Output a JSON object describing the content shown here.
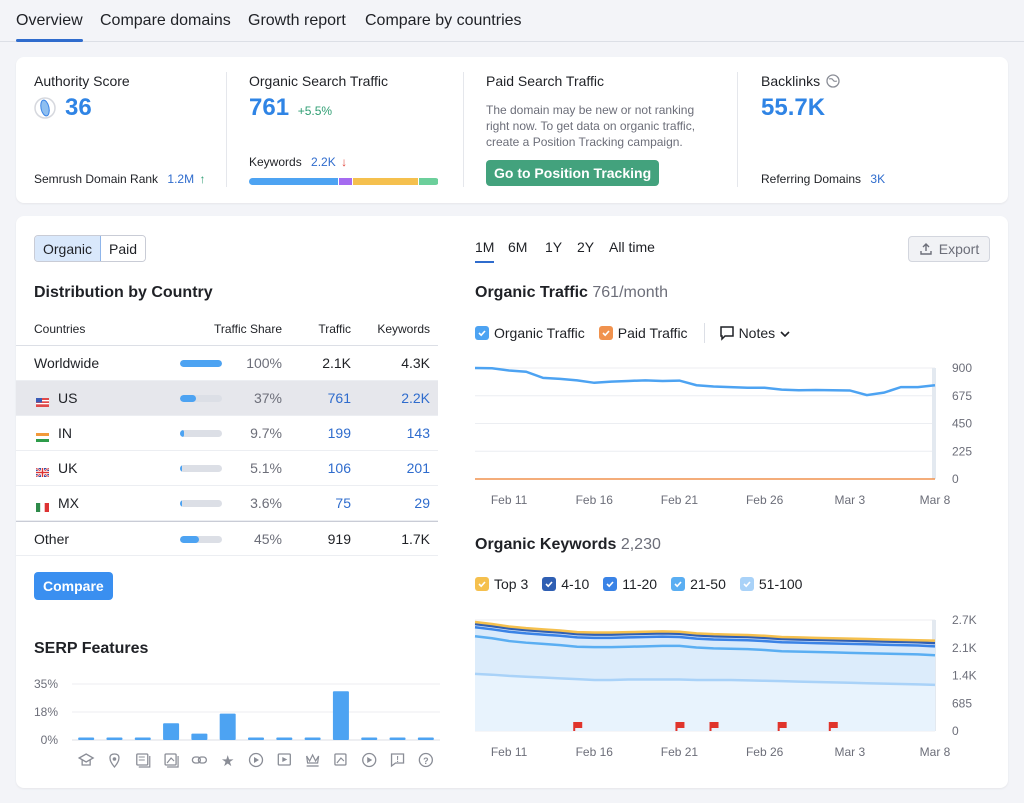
{
  "tabs": [
    {
      "label": "Overview",
      "active": true
    },
    {
      "label": "Compare domains",
      "active": false
    },
    {
      "label": "Growth report",
      "active": false
    },
    {
      "label": "Compare by countries",
      "active": false
    }
  ],
  "metrics": {
    "authority": {
      "label": "Authority Score",
      "value": "36",
      "rank_label": "Semrush Domain Rank",
      "rank_value": "1.2M",
      "rank_trend": "↑"
    },
    "organic": {
      "label": "Organic Search Traffic",
      "value": "761",
      "change": "+5.5%",
      "keywords_label": "Keywords",
      "keywords_value": "2.2K",
      "keywords_trend": "↓",
      "keyword_distribution": [
        {
          "name": "segment-1",
          "share": 0.48,
          "color": "#4da3f2"
        },
        {
          "name": "segment-2",
          "share": 0.07,
          "color": "#a56bf0"
        },
        {
          "name": "segment-3",
          "share": 0.35,
          "color": "#f5c04e"
        },
        {
          "name": "segment-4",
          "share": 0.1,
          "color": "#6ccf9b"
        }
      ]
    },
    "paid": {
      "label": "Paid Search Traffic",
      "description": "The domain may be new or not ranking right now. To get data on organic traffic, create a Position Tracking campaign.",
      "button": "Go to Position Tracking"
    },
    "backlinks": {
      "label": "Backlinks",
      "value": "55.7K",
      "ref_label": "Referring Domains",
      "ref_value": "3K"
    }
  },
  "toggle": {
    "options": [
      "Organic",
      "Paid"
    ],
    "selected": "Organic"
  },
  "distribution": {
    "title": "Distribution by Country",
    "columns": [
      "Countries",
      "Traffic Share",
      "Traffic",
      "Keywords"
    ],
    "rows": [
      {
        "country": "Worldwide",
        "flag": "",
        "share_pct": 100,
        "share": "100%",
        "traffic": "2.1K",
        "keywords": "4.3K",
        "link": false,
        "highlight": false
      },
      {
        "country": "US",
        "flag": "us",
        "share_pct": 37,
        "share": "37%",
        "traffic": "761",
        "keywords": "2.2K",
        "link": true,
        "highlight": true
      },
      {
        "country": "IN",
        "flag": "in",
        "share_pct": 9.7,
        "share": "9.7%",
        "traffic": "199",
        "keywords": "143",
        "link": true,
        "highlight": false
      },
      {
        "country": "UK",
        "flag": "uk",
        "share_pct": 5.1,
        "share": "5.1%",
        "traffic": "106",
        "keywords": "201",
        "link": true,
        "highlight": false
      },
      {
        "country": "MX",
        "flag": "mx",
        "share_pct": 3.6,
        "share": "3.6%",
        "traffic": "75",
        "keywords": "29",
        "link": true,
        "highlight": false
      },
      {
        "country": "Other",
        "flag": "",
        "share_pct": 45,
        "share": "45%",
        "traffic": "919",
        "keywords": "1.7K",
        "link": false,
        "highlight": false
      }
    ],
    "compare_button": "Compare"
  },
  "serp": {
    "title": "SERP Features",
    "y_ticks": [
      "35%",
      "18%",
      "0%"
    ],
    "ymax": 35,
    "features": [
      {
        "icon": "knowledge-panel-icon",
        "value": 0.5
      },
      {
        "icon": "local-pack-icon",
        "value": 0.5
      },
      {
        "icon": "featured-snippet-icon",
        "value": 0.5
      },
      {
        "icon": "image-pack-icon",
        "value": 10.5
      },
      {
        "icon": "sitelinks-icon",
        "value": 4
      },
      {
        "icon": "reviews-icon",
        "value": 16.5
      },
      {
        "icon": "video-icon",
        "value": 0.5
      },
      {
        "icon": "featured-video-icon",
        "value": 0.5
      },
      {
        "icon": "top-stories-icon",
        "value": 0.5
      },
      {
        "icon": "image-icon",
        "value": 30.5
      },
      {
        "icon": "video-carousel-icon",
        "value": 0.5
      },
      {
        "icon": "faq-icon",
        "value": 0.5
      },
      {
        "icon": "people-also-ask-icon",
        "value": 0.5
      }
    ]
  },
  "ranges": [
    {
      "label": "1M",
      "active": true
    },
    {
      "label": "6M",
      "active": false
    },
    {
      "label": "1Y",
      "active": false
    },
    {
      "label": "2Y",
      "active": false
    },
    {
      "label": "All time",
      "active": false
    }
  ],
  "export_label": "Export",
  "traffic_chart": {
    "title": "Organic Traffic",
    "subtitle": "761/month",
    "legend": [
      {
        "label": "Organic Traffic",
        "color": "#4da3f2",
        "checked": true
      },
      {
        "label": "Paid Traffic",
        "color": "#f0924e",
        "checked": true
      }
    ],
    "notes_label": "Notes"
  },
  "keywords_chart": {
    "title": "Organic Keywords",
    "subtitle": "2,230",
    "legend": [
      {
        "label": "Top 3",
        "color": "#f5c04e",
        "checked": true
      },
      {
        "label": "4-10",
        "color": "#2f5fb3",
        "checked": true
      },
      {
        "label": "11-20",
        "color": "#3a83e6",
        "checked": true
      },
      {
        "label": "21-50",
        "color": "#5aaef2",
        "checked": true
      },
      {
        "label": "51-100",
        "color": "#a9d2f8",
        "checked": true
      }
    ]
  },
  "chart_data": [
    {
      "type": "line",
      "title": "Organic Traffic 761/month",
      "x": [
        "Feb 9",
        "Feb 10",
        "Feb 11",
        "Feb 12",
        "Feb 13",
        "Feb 14",
        "Feb 15",
        "Feb 16",
        "Feb 17",
        "Feb 18",
        "Feb 19",
        "Feb 20",
        "Feb 21",
        "Feb 22",
        "Feb 23",
        "Feb 24",
        "Feb 25",
        "Feb 26",
        "Feb 27",
        "Feb 28",
        "Mar 1",
        "Mar 2",
        "Mar 3",
        "Mar 4",
        "Mar 5",
        "Mar 6",
        "Mar 7",
        "Mar 8"
      ],
      "x_ticks": [
        "Feb 11",
        "Feb 16",
        "Feb 21",
        "Feb 26",
        "Mar 3",
        "Mar 8"
      ],
      "y_ticks": [
        "900",
        "675",
        "450",
        "225",
        "0"
      ],
      "ylim": [
        0,
        900
      ],
      "series": [
        {
          "name": "Organic Traffic",
          "color": "#4da3f2",
          "values": [
            900,
            898,
            880,
            870,
            820,
            812,
            800,
            780,
            790,
            795,
            800,
            795,
            798,
            760,
            750,
            745,
            740,
            740,
            725,
            720,
            722,
            720,
            718,
            680,
            700,
            745,
            745,
            760
          ]
        },
        {
          "name": "Paid Traffic",
          "color": "#f0924e",
          "values": [
            0,
            0,
            0,
            0,
            0,
            0,
            0,
            0,
            0,
            0,
            0,
            0,
            0,
            0,
            0,
            0,
            0,
            0,
            0,
            0,
            0,
            0,
            0,
            0,
            0,
            0,
            0,
            0
          ]
        }
      ],
      "xlabel": "",
      "ylabel": "",
      "legend": "top-left",
      "grid": true
    },
    {
      "type": "area",
      "title": "Organic Keywords 2,230",
      "x": [
        "Feb 9",
        "Feb 10",
        "Feb 11",
        "Feb 12",
        "Feb 13",
        "Feb 14",
        "Feb 15",
        "Feb 16",
        "Feb 17",
        "Feb 18",
        "Feb 19",
        "Feb 20",
        "Feb 21",
        "Feb 22",
        "Feb 23",
        "Feb 24",
        "Feb 25",
        "Feb 26",
        "Feb 27",
        "Feb 28",
        "Mar 1",
        "Mar 2",
        "Mar 3",
        "Mar 4",
        "Mar 5",
        "Mar 6",
        "Mar 7",
        "Mar 8"
      ],
      "x_ticks": [
        "Feb 11",
        "Feb 16",
        "Feb 21",
        "Feb 26",
        "Mar 3",
        "Mar 8"
      ],
      "y_ticks": [
        "2.7K",
        "2.1K",
        "1.4K",
        "685",
        "0"
      ],
      "ylim": [
        0,
        2740
      ],
      "stacked_cumulative": true,
      "series": [
        {
          "name": "51-100",
          "color": "#a9d2f8",
          "values": [
            1410,
            1390,
            1360,
            1340,
            1320,
            1300,
            1280,
            1260,
            1260,
            1270,
            1270,
            1270,
            1270,
            1260,
            1260,
            1260,
            1250,
            1240,
            1230,
            1220,
            1210,
            1200,
            1190,
            1180,
            1170,
            1160,
            1150,
            1140
          ]
        },
        {
          "name": "21-50",
          "color": "#5aaef2",
          "values": [
            2340,
            2290,
            2220,
            2180,
            2150,
            2120,
            2080,
            2070,
            2070,
            2080,
            2090,
            2100,
            2100,
            2060,
            2040,
            2030,
            2020,
            2000,
            1970,
            1960,
            1950,
            1940,
            1930,
            1920,
            1910,
            1900,
            1890,
            1870
          ]
        },
        {
          "name": "11-20",
          "color": "#3a83e6",
          "values": [
            2560,
            2510,
            2450,
            2410,
            2380,
            2350,
            2310,
            2300,
            2300,
            2310,
            2320,
            2330,
            2320,
            2280,
            2260,
            2250,
            2240,
            2220,
            2190,
            2180,
            2170,
            2160,
            2150,
            2140,
            2130,
            2120,
            2110,
            2090
          ]
        },
        {
          "name": "4-10",
          "color": "#2f5fb3",
          "values": [
            2640,
            2590,
            2530,
            2490,
            2460,
            2430,
            2390,
            2380,
            2380,
            2390,
            2400,
            2410,
            2400,
            2360,
            2340,
            2330,
            2320,
            2300,
            2270,
            2260,
            2250,
            2240,
            2230,
            2220,
            2210,
            2200,
            2190,
            2170
          ]
        },
        {
          "name": "Top 3",
          "color": "#f5c04e",
          "values": [
            2690,
            2640,
            2580,
            2540,
            2510,
            2480,
            2440,
            2430,
            2430,
            2440,
            2450,
            2460,
            2450,
            2410,
            2390,
            2380,
            2370,
            2350,
            2320,
            2310,
            2300,
            2290,
            2280,
            2270,
            2260,
            2250,
            2240,
            2230
          ]
        }
      ],
      "annotations": [
        {
          "type": "note-flag",
          "x": "Feb 15"
        },
        {
          "type": "note-flag",
          "x": "Feb 21"
        },
        {
          "type": "note-flag",
          "x": "Feb 23"
        },
        {
          "type": "note-flag",
          "x": "Feb 27"
        },
        {
          "type": "note-flag",
          "x": "Mar 2"
        }
      ],
      "xlabel": "",
      "ylabel": "",
      "legend": "top-left",
      "grid": true
    }
  ]
}
